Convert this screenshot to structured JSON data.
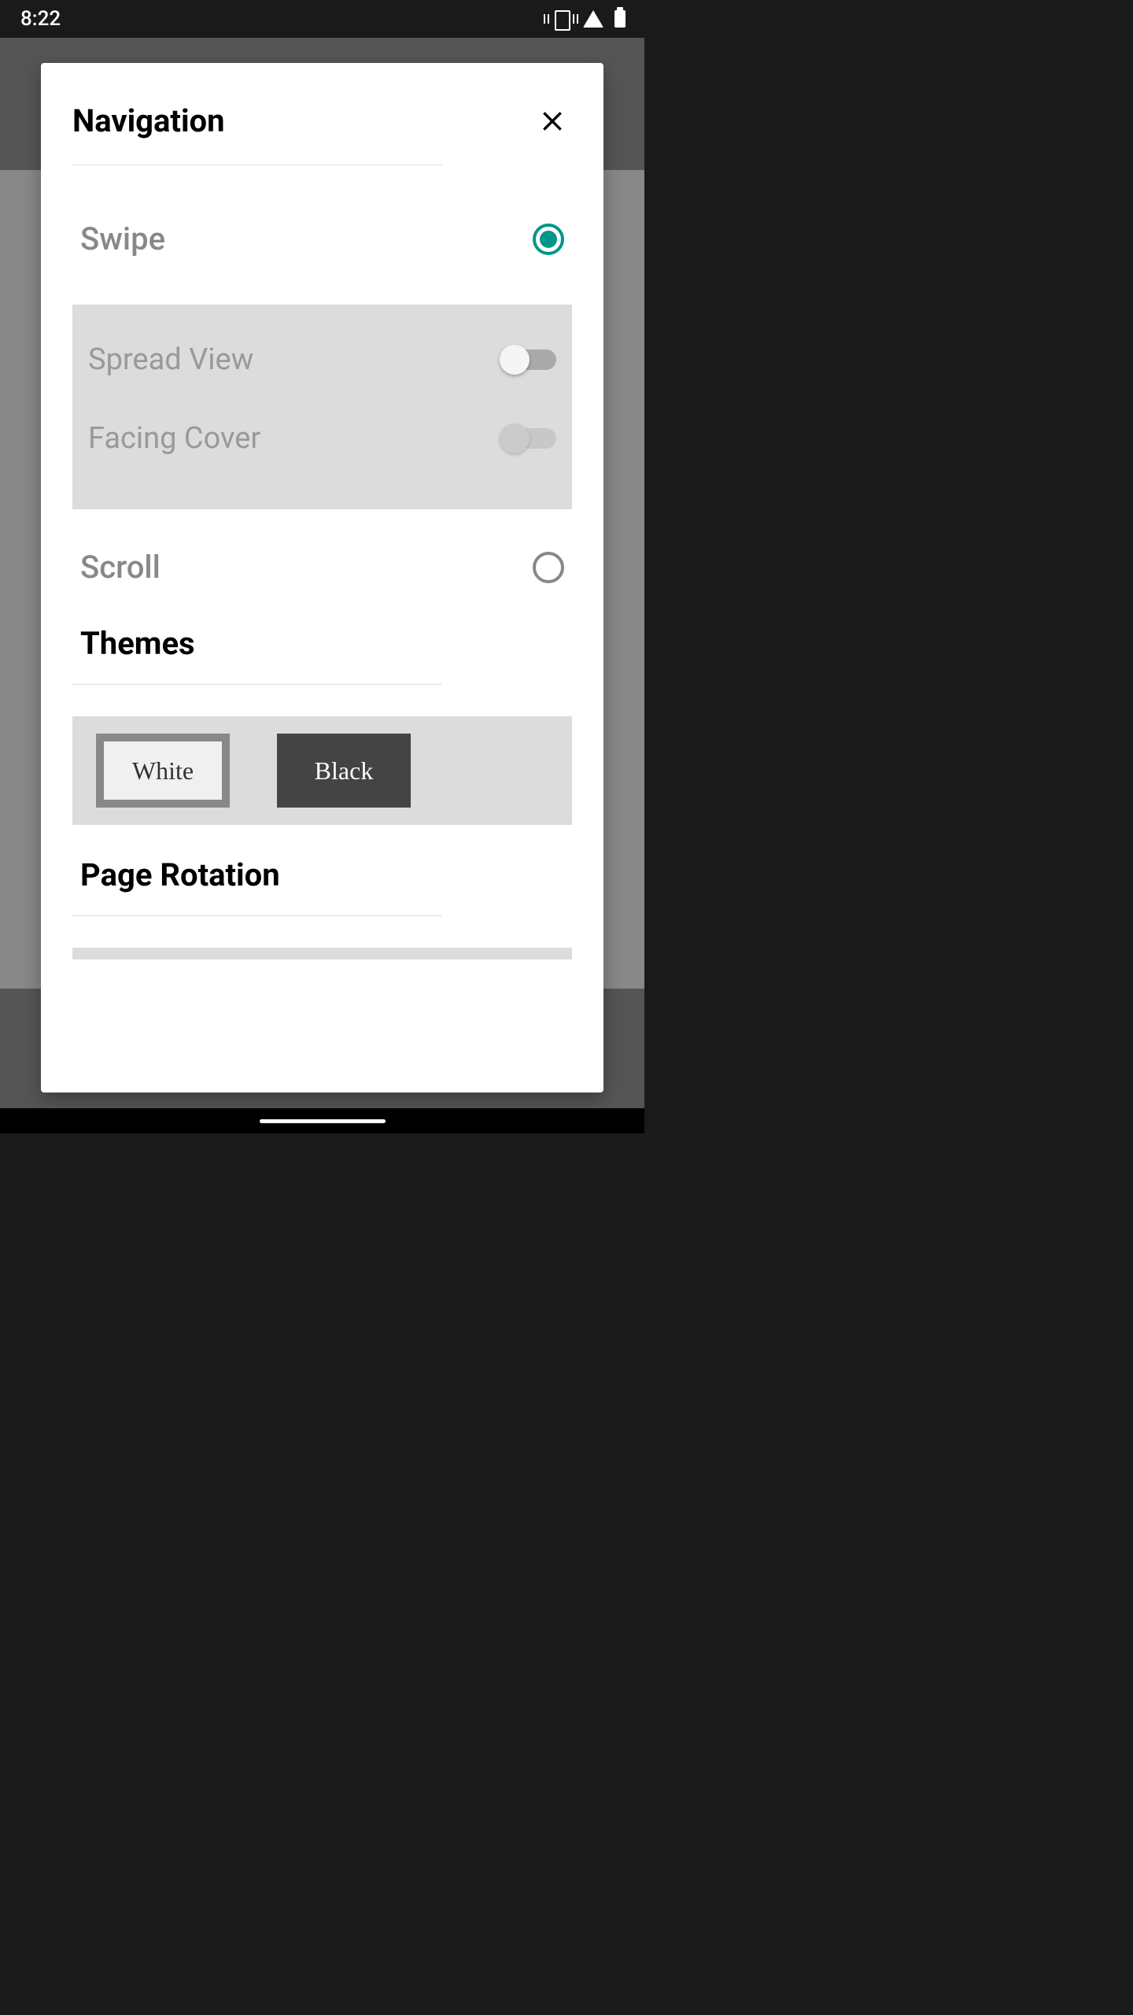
{
  "status": {
    "time": "8:22"
  },
  "dialog": {
    "title": "Navigation",
    "navigation": {
      "swipe_label": "Swipe",
      "scroll_label": "Scroll",
      "selected": "swipe",
      "spread_view_label": "Spread View",
      "spread_view_on": false,
      "facing_cover_label": "Facing Cover",
      "facing_cover_on": false,
      "facing_cover_disabled": true
    },
    "themes": {
      "title": "Themes",
      "options": [
        {
          "label": "White",
          "value": "white",
          "selected": true
        },
        {
          "label": "Black",
          "value": "black",
          "selected": false
        }
      ]
    },
    "page_rotation": {
      "title": "Page Rotation"
    }
  },
  "colors": {
    "accent": "#009688",
    "text_primary": "#000000",
    "text_secondary": "#888888",
    "panel_bg": "#dcdcdc"
  }
}
